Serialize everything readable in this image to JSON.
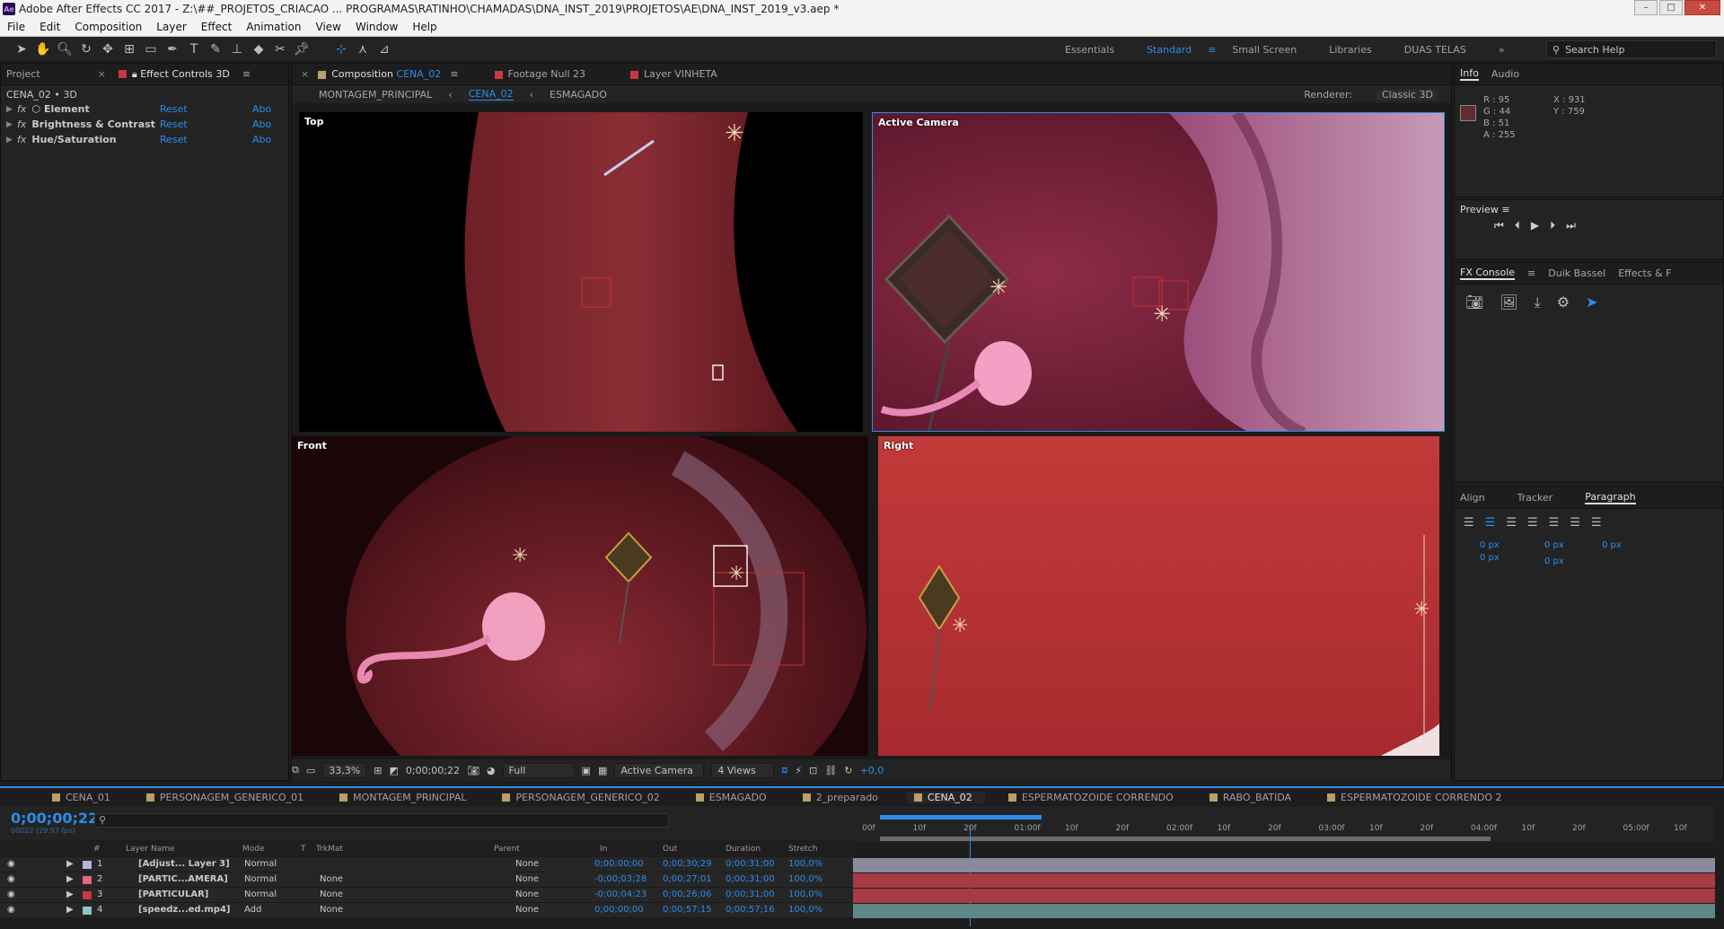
{
  "window": {
    "title": "Adobe After Effects CC 2017 - Z:\\##_PROJETOS_CRIACAO ... PROGRAMAS\\RATINHO\\CHAMADAS\\DNA_INST_2019\\PROJETOS\\AE\\DNA_INST_2019_v3.aep *",
    "app_badge": "Ae"
  },
  "menu": [
    "File",
    "Edit",
    "Composition",
    "Layer",
    "Effect",
    "Animation",
    "View",
    "Window",
    "Help"
  ],
  "workspaces": [
    "Essentials",
    "Standard",
    "Small Screen",
    "Libraries",
    "DUAS TELAS"
  ],
  "active_workspace": "Standard",
  "search_help": "Search Help",
  "left_panel": {
    "tabs": [
      "Project",
      "Effect Controls 3D"
    ],
    "breadcrumb": "CENA_02 • 3D",
    "effects": [
      {
        "name": "Element",
        "reset": "Reset",
        "about": "Abo"
      },
      {
        "name": "Brightness & Contrast",
        "reset": "Reset",
        "about": "Abo"
      },
      {
        "name": "Hue/Saturation",
        "reset": "Reset",
        "about": "Abo"
      }
    ]
  },
  "comp_panel": {
    "tabs": [
      "Composition CENA_02",
      "Footage Null 23",
      "Layer VINHETA"
    ],
    "comp_prefix": "Composition",
    "comp_name": "CENA_02",
    "footage_tab": "Footage Null 23",
    "layer_tab": "Layer VINHETA",
    "nav": [
      "MONTAGEM_PRINCIPAL",
      "CENA_02",
      "ESMAGADO"
    ],
    "renderer_label": "Renderer:",
    "renderer": "Classic 3D",
    "views": [
      "Top",
      "Active Camera",
      "Front",
      "Right"
    ]
  },
  "viewer_status": {
    "zoom": "33,3%",
    "time": "0;00;00;22",
    "resolution": "Full",
    "camera": "Active Camera",
    "layout": "4 Views",
    "exposure": "+0,0"
  },
  "right_panel": {
    "info_tabs": [
      "Info",
      "Audio"
    ],
    "color": {
      "r": "R : 95",
      "g": "G : 44",
      "b": "B : 51",
      "a": "A : 255",
      "swatch": "#5f2c33"
    },
    "coords": {
      "x": "X : 931",
      "y": "Y : 759"
    },
    "preview_title": "Preview",
    "fx_tabs": [
      "FX Console",
      "Duik Bassel",
      "Effects & F"
    ],
    "para_tabs": [
      "Align",
      "Tracker",
      "Paragraph"
    ],
    "para_values": [
      "0 px",
      "0 px",
      "0 px",
      "0 px",
      "0 px"
    ]
  },
  "timeline": {
    "tabs": [
      "CENA_01",
      "PERSONAGEM_GENERICO_01",
      "MONTAGEM_PRINCIPAL",
      "PERSONAGEM_GENERICO_02",
      "ESMAGADO",
      "2_preparado",
      "CENA_02",
      "ESPERMATOZOIDE CORRENDO",
      "RABO_BATIDA",
      "ESPERMATOZOIDE CORRENDO 2"
    ],
    "active_tab": "CENA_02",
    "timecode": "0;00;00;22",
    "fps": "00022 (29.97 fps)",
    "columns": [
      "#",
      "Layer Name",
      "Mode",
      "T",
      "TrkMat",
      "Parent",
      "In",
      "Out",
      "Duration",
      "Stretch"
    ],
    "layers": [
      {
        "num": "1",
        "name": "[Adjust... Layer 3]",
        "mode": "Normal",
        "trkmat": "",
        "parent": "None",
        "in": "0;00;00;00",
        "out": "0;00;30;29",
        "dur": "0;00;31;00",
        "stretch": "100,0%",
        "color": "#b3b3d9"
      },
      {
        "num": "2",
        "name": "[PARTIC...AMERA]",
        "mode": "Normal",
        "trkmat": "None",
        "parent": "None",
        "in": "-0;00;03;28",
        "out": "0;00;27;01",
        "dur": "0;00;31;00",
        "stretch": "100,0%",
        "color": "#e06a7a"
      },
      {
        "num": "3",
        "name": "[PARTICULAR]",
        "mode": "Normal",
        "trkmat": "None",
        "parent": "None",
        "in": "-0;00;04;23",
        "out": "0;00;26;06",
        "dur": "0;00;31;00",
        "stretch": "100,0%",
        "color": "#c8383f"
      },
      {
        "num": "4",
        "name": "[speedz...ed.mp4]",
        "mode": "Add",
        "trkmat": "None",
        "parent": "None",
        "in": "0;00;00;00",
        "out": "0;00;57;15",
        "dur": "0;00;57;16",
        "stretch": "100,0%",
        "color": "#8ec6c6"
      }
    ],
    "ruler": [
      "00f",
      "10f",
      "20f",
      "01:00f",
      "10f",
      "20f",
      "02:00f",
      "10f",
      "20f",
      "03:00f",
      "10f",
      "20f",
      "04:00f",
      "10f",
      "20f",
      "05:00f",
      "10f"
    ]
  }
}
